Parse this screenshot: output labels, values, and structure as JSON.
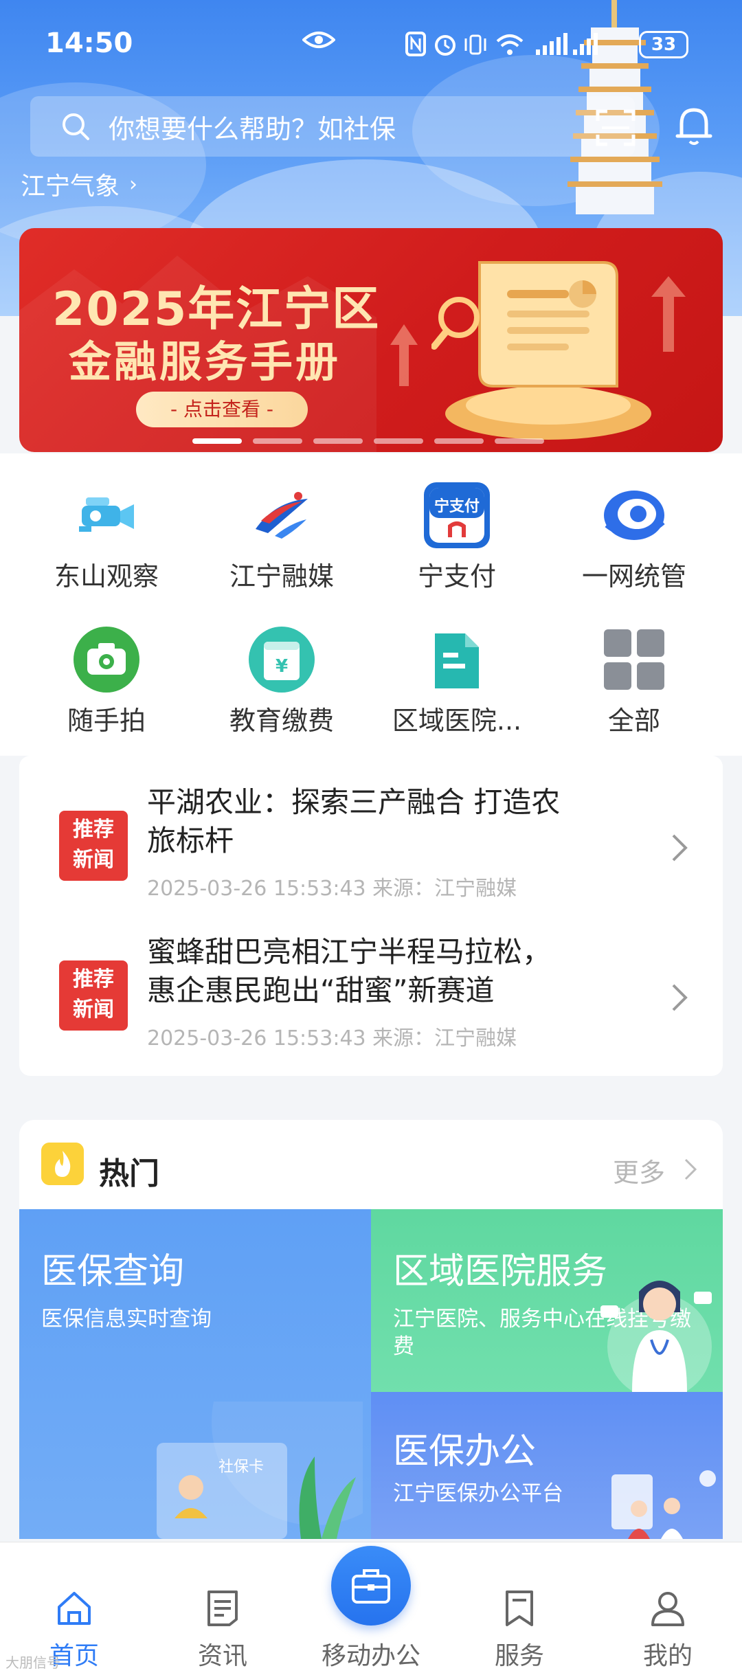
{
  "status": {
    "time": "14:50",
    "battery": "33"
  },
  "header": {
    "search_placeholder": "你想要什么帮助？如社保",
    "weather": "江宁气象"
  },
  "banner": {
    "title_line1": "2025年江宁区",
    "title_line2": "金融服务手册",
    "button": "- 点击查看 -",
    "dot_count": 6,
    "active_dot": 1
  },
  "quick": {
    "items": [
      {
        "label": "东山观察",
        "icon": "camera-drone-icon"
      },
      {
        "label": "江宁融媒",
        "icon": "media-logo-icon"
      },
      {
        "label": "宁支付",
        "icon": "ning-pay-icon",
        "badge": "宁支付"
      },
      {
        "label": "一网统管",
        "icon": "eye-network-icon"
      },
      {
        "label": "随手拍",
        "icon": "camera-icon"
      },
      {
        "label": "教育缴费",
        "icon": "tuition-payment-icon",
        "symbol": "¥"
      },
      {
        "label": "区域医院...",
        "icon": "hospital-doc-icon"
      },
      {
        "label": "全部",
        "icon": "grid-all-icon"
      }
    ]
  },
  "news": {
    "tag_line1": "推荐",
    "tag_line2": "新闻",
    "items": [
      {
        "title_line1": "平湖农业：探索三产融合 打造农",
        "title_line2": "旅标杆",
        "meta": "2025-03-26 15:53:43 来源：江宁融媒"
      },
      {
        "title_line1": "蜜蜂甜巴亮相江宁半程马拉松，",
        "title_line2": "惠企惠民跑出“甜蜜”新赛道",
        "meta": "2025-03-26 15:53:43 来源：江宁融媒"
      }
    ]
  },
  "hot": {
    "title": "热门",
    "more": "更多",
    "cards": [
      {
        "title": "医保查询",
        "subtitle": "医保信息实时查询",
        "illustration_text": "社保卡"
      },
      {
        "title": "区域医院服务",
        "subtitle": "江宁医院、服务中心在线挂号缴费"
      },
      {
        "title": "医保办公",
        "subtitle": "江宁医保办公平台"
      }
    ]
  },
  "nav": {
    "items": [
      {
        "label": "首页",
        "icon": "home-icon",
        "active": true
      },
      {
        "label": "资讯",
        "icon": "news-icon",
        "active": false
      },
      {
        "label": "移动办公",
        "icon": "briefcase-icon",
        "active": false
      },
      {
        "label": "服务",
        "icon": "bookmark-icon",
        "active": false
      },
      {
        "label": "我的",
        "icon": "user-icon",
        "active": false
      }
    ]
  },
  "colors": {
    "accent": "#2f7cf6",
    "banner_red": "#d01c1c",
    "tag_red": "#e53a36",
    "gold_text": "#ffe6b2"
  },
  "watermark": "大朋信号"
}
